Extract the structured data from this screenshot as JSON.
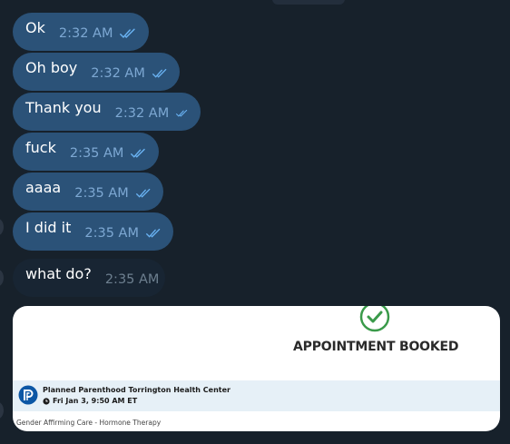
{
  "messages": [
    {
      "text": "Ok",
      "time": "2:32 AM",
      "direction": "outgoing",
      "read": true
    },
    {
      "text": "Oh boy",
      "time": "2:32 AM",
      "direction": "outgoing",
      "read": true
    },
    {
      "text": "Thank you",
      "time": "2:32 AM",
      "direction": "outgoing",
      "read": true
    },
    {
      "text": "fuck",
      "time": "2:35 AM",
      "direction": "outgoing",
      "read": true
    },
    {
      "text": "aaaa",
      "time": "2:35 AM",
      "direction": "outgoing",
      "read": true
    },
    {
      "text": "I did it",
      "time": "2:35 AM",
      "direction": "outgoing",
      "read": true
    },
    {
      "text": "what do?",
      "time": "2:35 AM",
      "direction": "incoming",
      "read": false
    }
  ],
  "appointment_card": {
    "status": "APPOINTMENT BOOKED",
    "health_center": "Planned Parenthood Torrington Health Center",
    "date_time": "Fri Jan 3, 9:50 AM ET",
    "service": "Gender Affirming Care - Hormone Therapy"
  },
  "icons": {
    "read_receipt": "double-check-icon",
    "booked": "check-circle-icon",
    "logo": "planned-parenthood-logo",
    "clock": "clock-icon"
  },
  "colors": {
    "background": "#17212b",
    "outgoing_bubble": "#2b5278",
    "incoming_bubble": "#182533",
    "read_check": "#6ab3f3",
    "booked_green": "#3a9a4a",
    "info_band": "#e6f0f7"
  }
}
